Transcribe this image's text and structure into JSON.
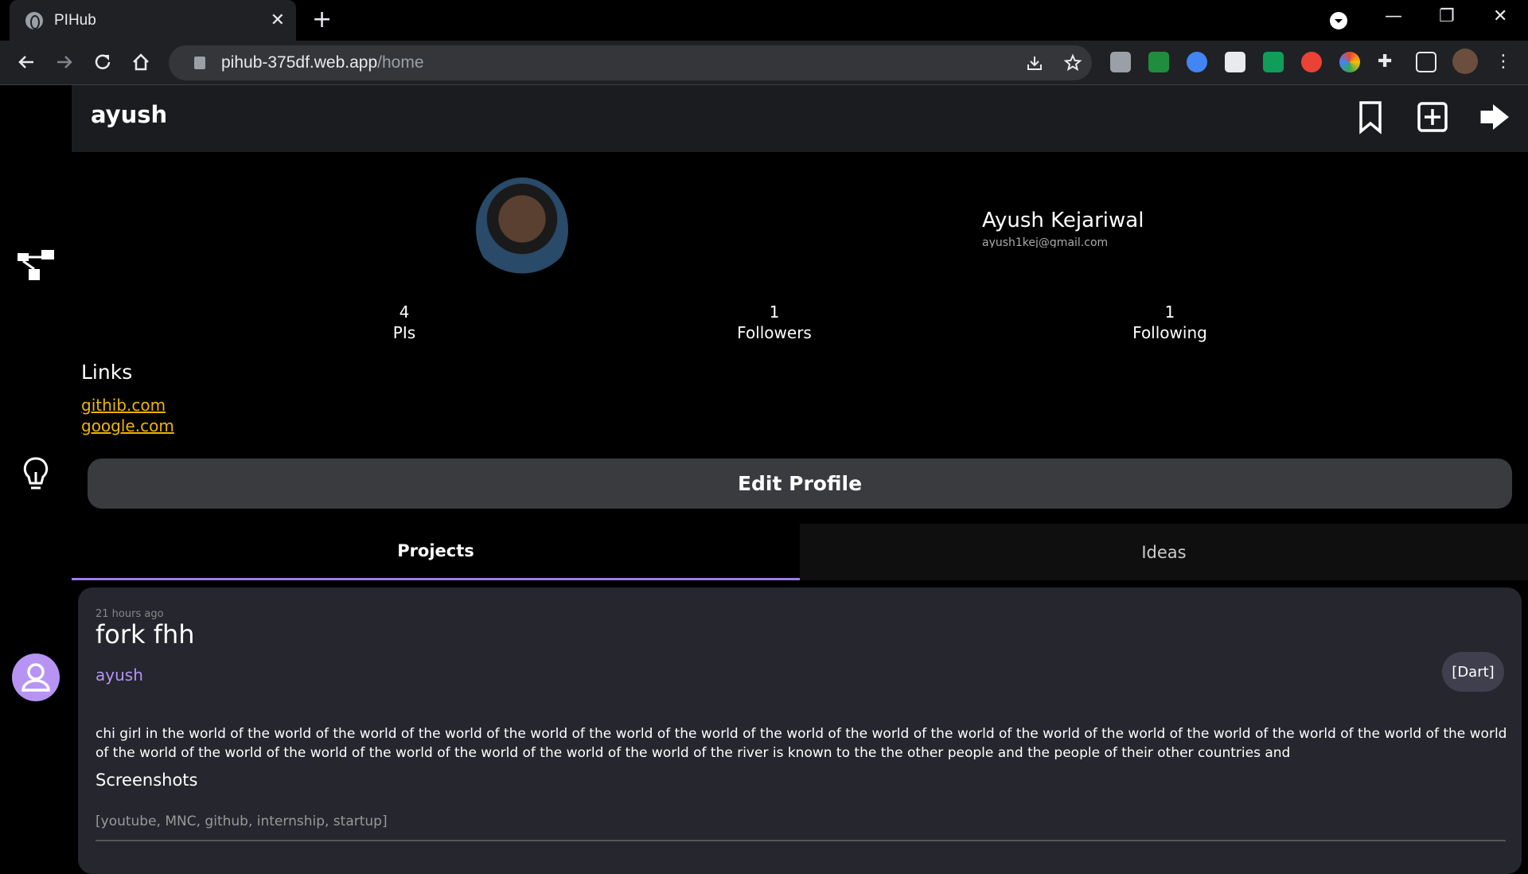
{
  "browser": {
    "tab_title": "PIHub",
    "new_tab": "+",
    "url_host": "pihub-375df.web.app",
    "url_path": "/home"
  },
  "header": {
    "username": "ayush"
  },
  "profile": {
    "name": "Ayush Kejariwal",
    "email": "ayush1kej@gmail.com",
    "stats": [
      {
        "value": "4",
        "label": "PIs"
      },
      {
        "value": "1",
        "label": "Followers"
      },
      {
        "value": "1",
        "label": "Following"
      }
    ],
    "links_title": "Links",
    "links": [
      "githib.com",
      "google.com"
    ],
    "edit_label": "Edit Profile"
  },
  "tabs": {
    "projects": "Projects",
    "ideas": "Ideas"
  },
  "card": {
    "time": "21 hours ago",
    "title": "fork fhh",
    "author": "ayush",
    "tag": "[Dart]",
    "description": "chi girl in the world of the world of the world of the world of the world of the world of the world of the world of the world of the world of the world of the world of the world of the world of the world of the world of the world of the world of the world of the world of the world of the world of the world of the river is known to the the other people and the people of their other countries and",
    "screenshots_label": "Screenshots",
    "keywords": "[youtube, MNC, github, internship, startup]"
  },
  "colors": {
    "accent": "#9f7aea",
    "link": "#f0b400",
    "author": "#b794f4"
  }
}
